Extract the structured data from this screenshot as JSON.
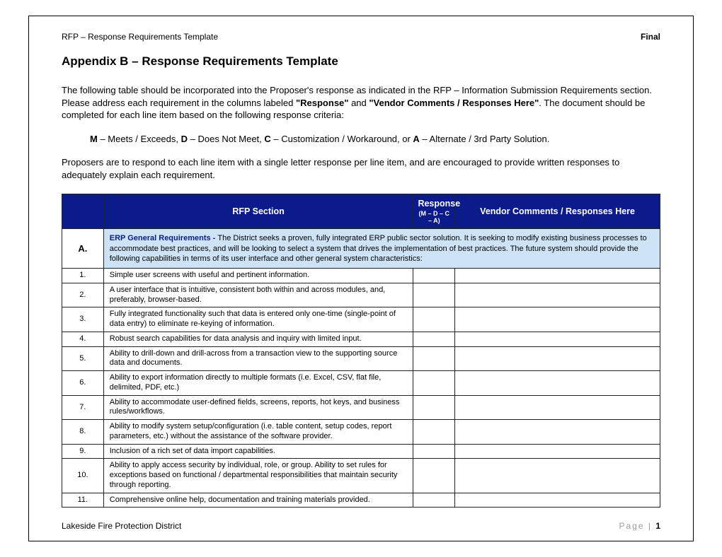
{
  "header": {
    "left": "RFP – Response Requirements Template",
    "right": "Final"
  },
  "title": "Appendix B – Response Requirements Template",
  "intro_parts": {
    "p1a": "The following table should be incorporated into the Proposer's response as indicated in the RFP – Information Submission Requirements section.  Please address each requirement in the columns labeled ",
    "p1b": "\"Response\"",
    "p1c": " and ",
    "p1d": "\"Vendor Comments / Responses Here\"",
    "p1e": ". The document should be completed for each line item based on the following response criteria:"
  },
  "criteria": {
    "m": "M",
    "m_txt": " – Meets / Exceeds, ",
    "d": "D",
    "d_txt": " – Does Not Meet, ",
    "c": "C",
    "c_txt": " – Customization / Workaround, or ",
    "a": "A",
    "a_txt": " – Alternate / 3rd Party Solution."
  },
  "note": "Proposers are to respond to each line item with a single letter response per line item, and are encouraged to provide written responses to adequately explain each requirement.",
  "table": {
    "headers": {
      "num": "",
      "section": "RFP Section",
      "response": "Response",
      "response_sub": "(M – D – C – A)",
      "vendor": "Vendor Comments / Responses Here"
    },
    "section": {
      "letter": "A.",
      "title": "ERP General Requirements - ",
      "body": "The District seeks a proven, fully integrated ERP public sector solution.  It is seeking to modify existing business processes to accommodate best practices, and will be looking to select a system that drives the implementation of best practices.  The future system should provide the following capabilities in terms of its user interface and other general system characteristics:"
    },
    "items": [
      {
        "n": "1.",
        "txt": "Simple user screens with useful and pertinent information."
      },
      {
        "n": "2.",
        "txt": "A user interface that is intuitive, consistent both within and across modules, and, preferably, browser-based."
      },
      {
        "n": "3.",
        "txt": "Fully integrated functionality such that data is entered only one-time (single-point of data entry) to eliminate re-keying of information."
      },
      {
        "n": "4.",
        "txt": "Robust search capabilities for data analysis and inquiry with limited input."
      },
      {
        "n": "5.",
        "txt": "Ability to drill-down and drill-across from a transaction view to the supporting source data and documents."
      },
      {
        "n": "6.",
        "txt": "Ability to export information directly to multiple formats (i.e. Excel, CSV, flat file, delimited, PDF, etc.)"
      },
      {
        "n": "7.",
        "txt": "Ability to accommodate user-defined fields, screens, reports, hot keys, and business rules/workflows."
      },
      {
        "n": "8.",
        "txt": "Ability to modify system setup/configuration (i.e. table content, setup codes, report parameters, etc.) without the assistance of the software provider."
      },
      {
        "n": "9.",
        "txt": "Inclusion of a rich set of data import capabilities."
      },
      {
        "n": "10.",
        "txt": "Ability to apply access security by individual, role, or group.  Ability to set rules for exceptions based on functional / departmental responsibilities that maintain security through reporting."
      },
      {
        "n": "11.",
        "txt": "Comprehensive online help, documentation and training materials provided."
      }
    ]
  },
  "footer": {
    "left": "Lakeside Fire Protection District",
    "page_word": "Page",
    "page_sep": " | ",
    "page_num": "1"
  }
}
